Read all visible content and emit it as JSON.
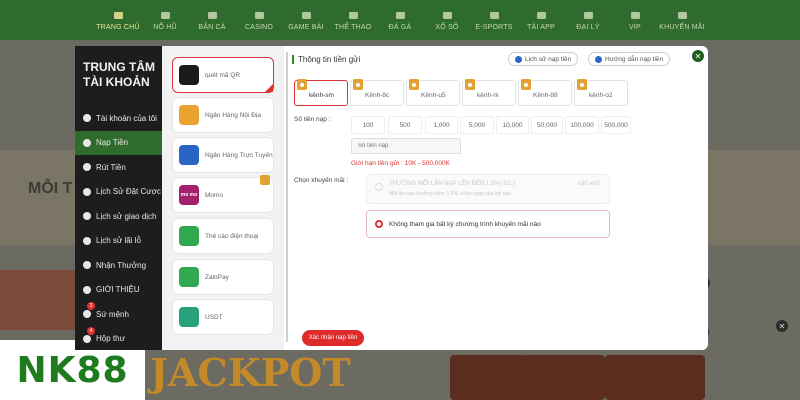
{
  "nav": {
    "items": [
      {
        "label": "TRANG CHỦ",
        "icon": "home-icon"
      },
      {
        "label": "NỔ HŨ",
        "icon": "jar-icon"
      },
      {
        "label": "BẮN CÁ",
        "icon": "fish-icon"
      },
      {
        "label": "CASINO",
        "icon": "casino-icon"
      },
      {
        "label": "GAME BÀI",
        "icon": "cards-icon"
      },
      {
        "label": "THỂ THAO",
        "icon": "ball-icon"
      },
      {
        "label": "ĐÁ GÀ",
        "icon": "rooster-icon"
      },
      {
        "label": "XỔ SỐ",
        "icon": "lottery-icon"
      },
      {
        "label": "E-SPORTS",
        "icon": "gamepad-icon"
      },
      {
        "label": "TẢI APP",
        "icon": "download-icon"
      },
      {
        "label": "ĐẠI LÝ",
        "icon": "agent-icon"
      },
      {
        "label": "VIP",
        "icon": "crown-icon"
      },
      {
        "label": "KHUYẾN MÃI",
        "icon": "gift-icon"
      }
    ]
  },
  "background": {
    "side_text": "MỖI T",
    "jackpot": "JACKPOT",
    "brand": "NK88"
  },
  "account": {
    "title_line1": "TRUNG TÂM",
    "title_line2": "TÀI KHOẢN",
    "items": [
      {
        "label": "Tài khoản của tôi"
      },
      {
        "label": "Nạp Tiền"
      },
      {
        "label": "Rút Tiền"
      },
      {
        "label": "Lịch Sử Đặt Cược"
      },
      {
        "label": "Lịch sử giao dịch"
      },
      {
        "label": "Lịch sử lãi lỗ"
      },
      {
        "label": "Nhận Thưởng"
      },
      {
        "label": "GIỚI THIỆU"
      },
      {
        "label": "Sứ mệnh",
        "badge": "3"
      },
      {
        "label": "Hộp thư",
        "badge": "4"
      }
    ]
  },
  "methods": [
    {
      "label": "quét mã QR",
      "color": "#1a1a1a"
    },
    {
      "label": "Ngân Hàng Nội Địa",
      "color": "#e8a330"
    },
    {
      "label": "Ngân Hàng Trực Tuyến",
      "color": "#2a64c4"
    },
    {
      "label": "Momo",
      "color": "#a5206b",
      "icon_text": "mo mo"
    },
    {
      "label": "Thẻ cào điện thoại",
      "color": "#2fa84f"
    },
    {
      "label": "ZaloPay",
      "color": "#32a852"
    },
    {
      "label": "USDT",
      "color": "#26a17b"
    }
  ],
  "main": {
    "section_title": "Thông tin tiền gửi",
    "history_btn": "Lịch sử nạp tiền",
    "guide_btn": "Hướng dẫn nạp tiền",
    "channels": [
      "kênh-sm",
      "Kênh-8c",
      "Kênh-u5",
      "kênh-rk",
      "Kênh-88",
      "kênh-o2"
    ],
    "amount_label": "Số tiền nạp :",
    "amounts": [
      "100",
      "500",
      "1,000",
      "5,000",
      "10,000",
      "50,000",
      "100,000",
      "500,000"
    ],
    "amount_placeholder": "Số tiền nạp",
    "limit_text": "Giới hạn tiền gửi : 10K - 500,000K",
    "promo_label": "Chọn khuyến mãi :",
    "promo1_title": "THƯỞNG MỖI LẦN NẠP LÊN ĐẾN 1.5%( 5/1 )",
    "promo1_right": "≥30 vnđ",
    "promo1_sub": "Mỗi lần nạp thưởng thêm 1.5%, nhận ngay sau khi nạp",
    "promo2_title": "Không tham gia bất kỳ chương trình khuyến mãi nào",
    "submit": "Xác nhận nạp tiền"
  }
}
